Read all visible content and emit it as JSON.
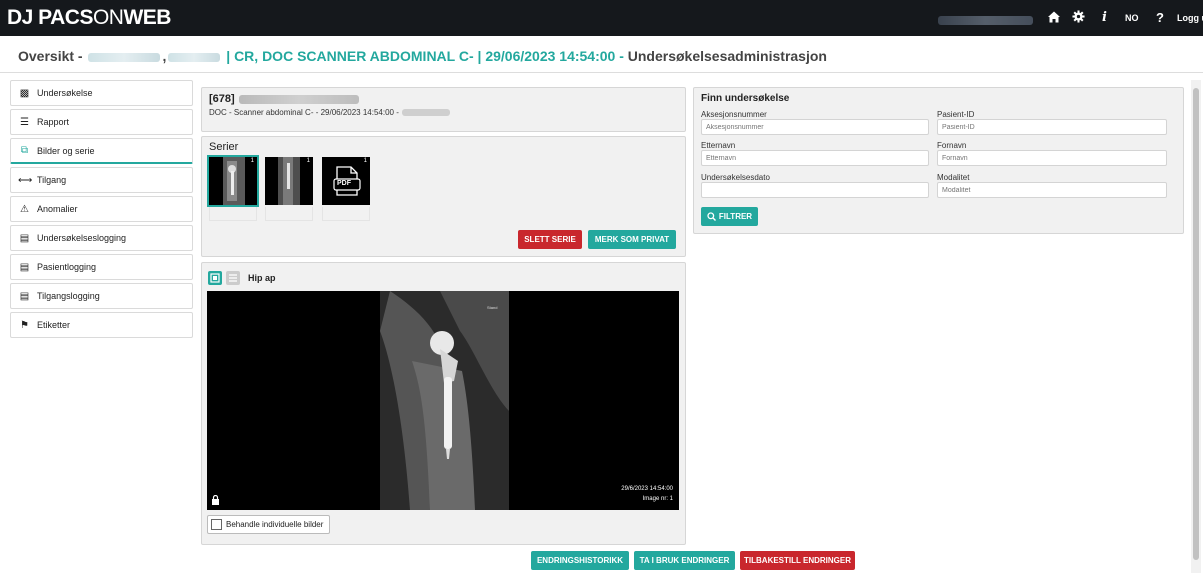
{
  "brand": {
    "logo_bold": "DJ PACS",
    "logo_thin": "ON",
    "logo_end": "WEB"
  },
  "topbar": {
    "home_icon": "home-icon",
    "settings_icon": "gear-icon",
    "info": "i",
    "language": "NO",
    "help": "?",
    "logout": "Logg ut"
  },
  "breadcrumb": {
    "overview": "Oversikt -",
    "comma": ",",
    "rest": "| CR, DOC SCANNER ABDOMINAL C- | 29/06/2023 14:54:00 -",
    "page": "Undersøkelsesadministrasjon"
  },
  "sidebar": {
    "items": [
      {
        "label": "Undersøkelse",
        "icon": "exam-icon"
      },
      {
        "label": "Rapport",
        "icon": "report-icon"
      },
      {
        "label": "Bilder og serie",
        "icon": "images-icon"
      },
      {
        "label": "Tilgang",
        "icon": "share-icon"
      },
      {
        "label": "Anomalier",
        "icon": "warning-icon"
      },
      {
        "label": "Undersøkelseslogging",
        "icon": "log-icon"
      },
      {
        "label": "Pasientlogging",
        "icon": "log-icon"
      },
      {
        "label": "Tilgangslogging",
        "icon": "log-icon"
      },
      {
        "label": "Etiketter",
        "icon": "tag-icon"
      }
    ],
    "active": "Bilder og serie"
  },
  "exam": {
    "id": "[678]",
    "desc": "DOC - Scanner abdominal C- - 29/06/2023 14:54:00 -"
  },
  "series": {
    "title": "Serier",
    "thumbs": [
      {
        "count": "1",
        "kind": "xray"
      },
      {
        "count": "1",
        "kind": "xray"
      },
      {
        "count": "1",
        "kind": "pdf",
        "label": "PDF"
      }
    ],
    "delete_button": "SLETT SERIE",
    "private_button": "MERK SOM PRIVAT"
  },
  "viewer": {
    "series_name": "Hip ap",
    "side_marker": "Stand",
    "date": "29/6/2023 14:54:00",
    "image_nr": "Image nr: 1",
    "individual_checkbox": "Behandle individuelle bilder"
  },
  "search": {
    "title": "Finn undersøkelse",
    "fields": [
      {
        "label": "Aksesjonsnummer",
        "placeholder": "Aksesjonsnummer"
      },
      {
        "label": "Pasient-ID",
        "placeholder": "Pasient-ID"
      },
      {
        "label": "Etternavn",
        "placeholder": "Etternavn"
      },
      {
        "label": "Fornavn",
        "placeholder": "Fornavn"
      },
      {
        "label": "Undersøkelsesdato",
        "placeholder": ""
      },
      {
        "label": "Modalitet",
        "placeholder": "Modalitet"
      }
    ],
    "filter_button": "FILTRER"
  },
  "footer": {
    "history_button": "ENDRINGSHISTORIKK",
    "apply_button": "TA I BRUK ENDRINGER",
    "reset_button": "TILBAKESTILL ENDRINGER"
  },
  "colors": {
    "accent": "#23a89e",
    "danger": "#c9272d",
    "topbar": "#15181c"
  }
}
